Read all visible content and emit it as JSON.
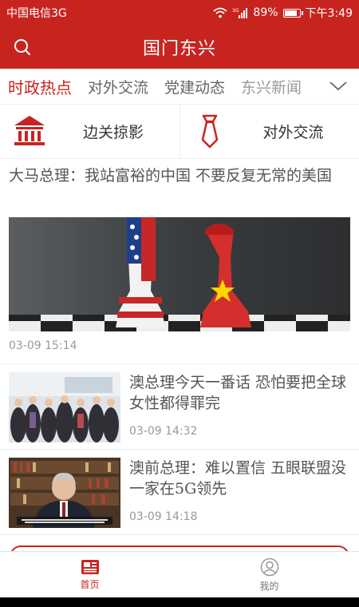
{
  "status_bar": {
    "carrier": "中国电信3G",
    "network_badge": "3G",
    "battery_percent": "89%",
    "battery_level": 0.89,
    "time": "下午3:49"
  },
  "app_bar": {
    "title": "国门东兴",
    "search_icon": "search-icon"
  },
  "tabs": {
    "items": [
      "时政热点",
      "对外交流",
      "党建动态",
      "东兴新闻"
    ],
    "active_index": 0,
    "more_icon": "chevron-down-icon"
  },
  "quick_links": [
    {
      "label": "边关掠影",
      "icon": "temple-icon"
    },
    {
      "label": "对外交流",
      "icon": "necktie-icon"
    }
  ],
  "feature": {
    "title": "大马总理：我站富裕的中国 不要反复无常的美国",
    "time": "03-09  15:14"
  },
  "news": [
    {
      "title": "澳总理今天一番话 恐怕要把全球女性都得罪完",
      "time": "03-09  14:32"
    },
    {
      "title": "澳前总理：难以置信 五眼联盟没一家在5G领先",
      "time": "03-09  14:18"
    }
  ],
  "bottom_nav": [
    {
      "label": "首页",
      "icon": "news-icon",
      "active": true
    },
    {
      "label": "我的",
      "icon": "profile-icon",
      "active": false
    }
  ],
  "colors": {
    "brand_red": "#c8241f",
    "muted_text": "#999999"
  }
}
